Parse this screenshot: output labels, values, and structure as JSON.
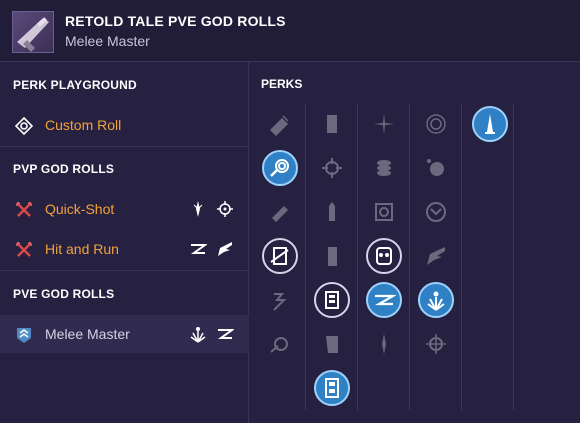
{
  "header": {
    "title": "RETOLD TALE PVE GOD ROLLS",
    "subtitle": "Melee Master"
  },
  "sidebar": {
    "sections": [
      {
        "title": "PERK PLAYGROUND",
        "items": [
          {
            "label": "Custom Roll",
            "icon": "target-diamond-icon"
          }
        ]
      },
      {
        "title": "PVP GOD ROLLS",
        "items": [
          {
            "label": "Quick-Shot",
            "icon": "crossed-swords-icon",
            "tags": [
              "rangefinder-icon",
              "crosshair-icon"
            ]
          },
          {
            "label": "Hit and Run",
            "icon": "crossed-swords-icon",
            "tags": [
              "dash-icon",
              "wing-icon"
            ]
          }
        ]
      },
      {
        "title": "PVE GOD ROLLS",
        "items": [
          {
            "label": "Melee Master",
            "icon": "chevron-shield-icon",
            "tags": [
              "burst-icon",
              "dash-icon"
            ]
          }
        ]
      }
    ]
  },
  "perks": {
    "title": "PERKS",
    "accent": "#2f80c4"
  }
}
